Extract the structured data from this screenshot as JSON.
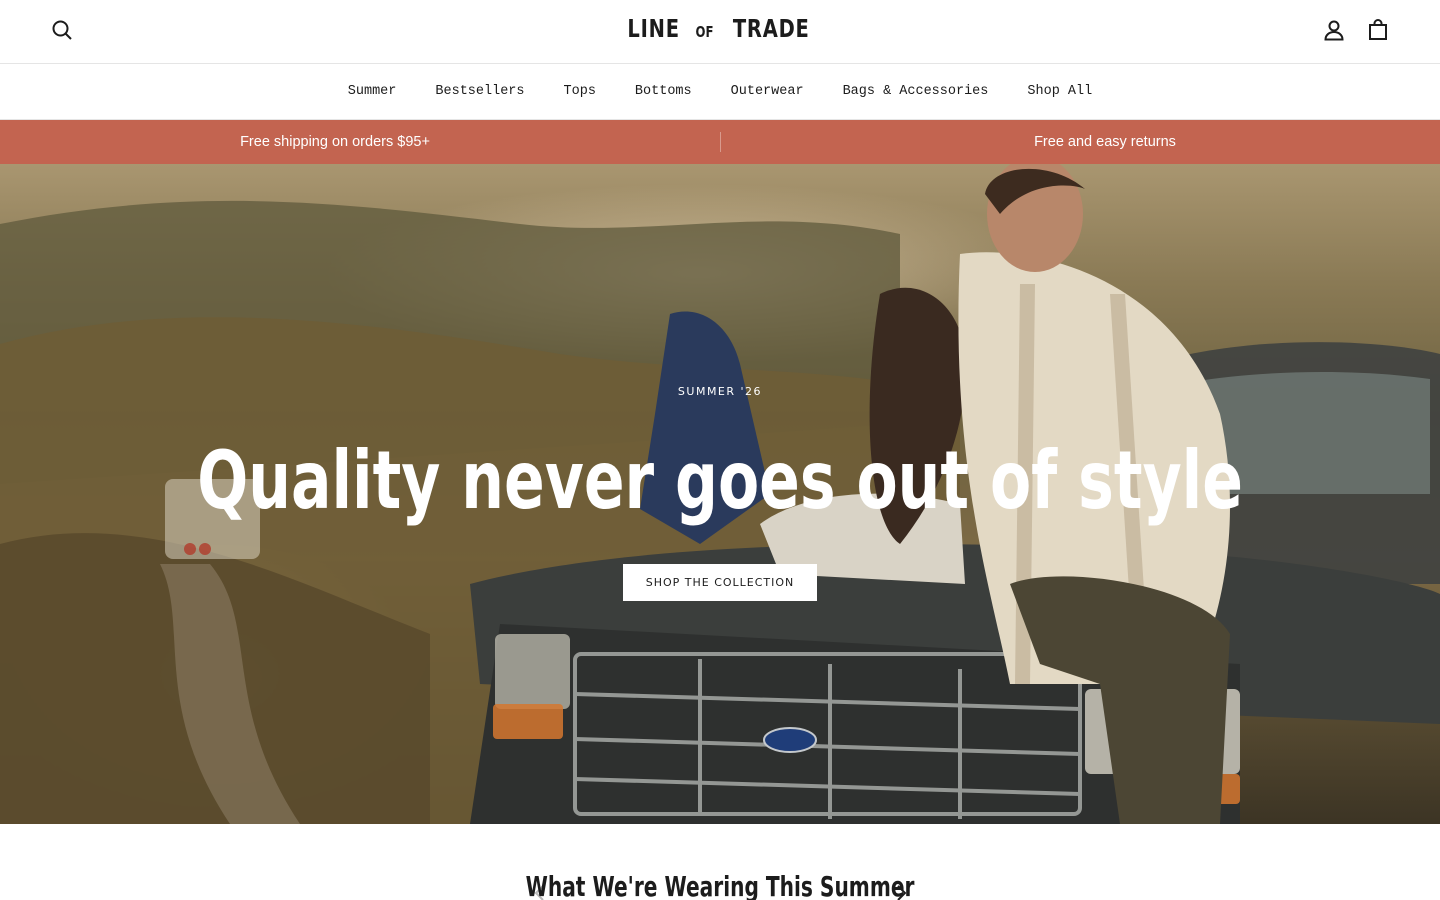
{
  "header": {
    "logo_main_1": "LINE",
    "logo_small": "OF",
    "logo_main_2": "TRADE",
    "icons": {
      "search": "search-icon",
      "account": "account-icon",
      "cart": "cart-icon"
    }
  },
  "nav": {
    "items": [
      {
        "label": "Summer"
      },
      {
        "label": "Bestsellers"
      },
      {
        "label": "Tops"
      },
      {
        "label": "Bottoms"
      },
      {
        "label": "Outerwear"
      },
      {
        "label": "Bags & Accessories"
      },
      {
        "label": "Shop All"
      }
    ]
  },
  "announcement": {
    "left": "Free shipping on orders $95+",
    "right": "Free and easy returns",
    "background": "#c36450"
  },
  "hero": {
    "eyebrow": "SUMMER '26",
    "headline": "Quality never goes out of style",
    "cta_label": "SHOP THE COLLECTION"
  },
  "collection": {
    "title": "What We're Wearing This Summer",
    "icons": {
      "prev": "chevron-left-icon",
      "next": "chevron-right-icon"
    }
  }
}
